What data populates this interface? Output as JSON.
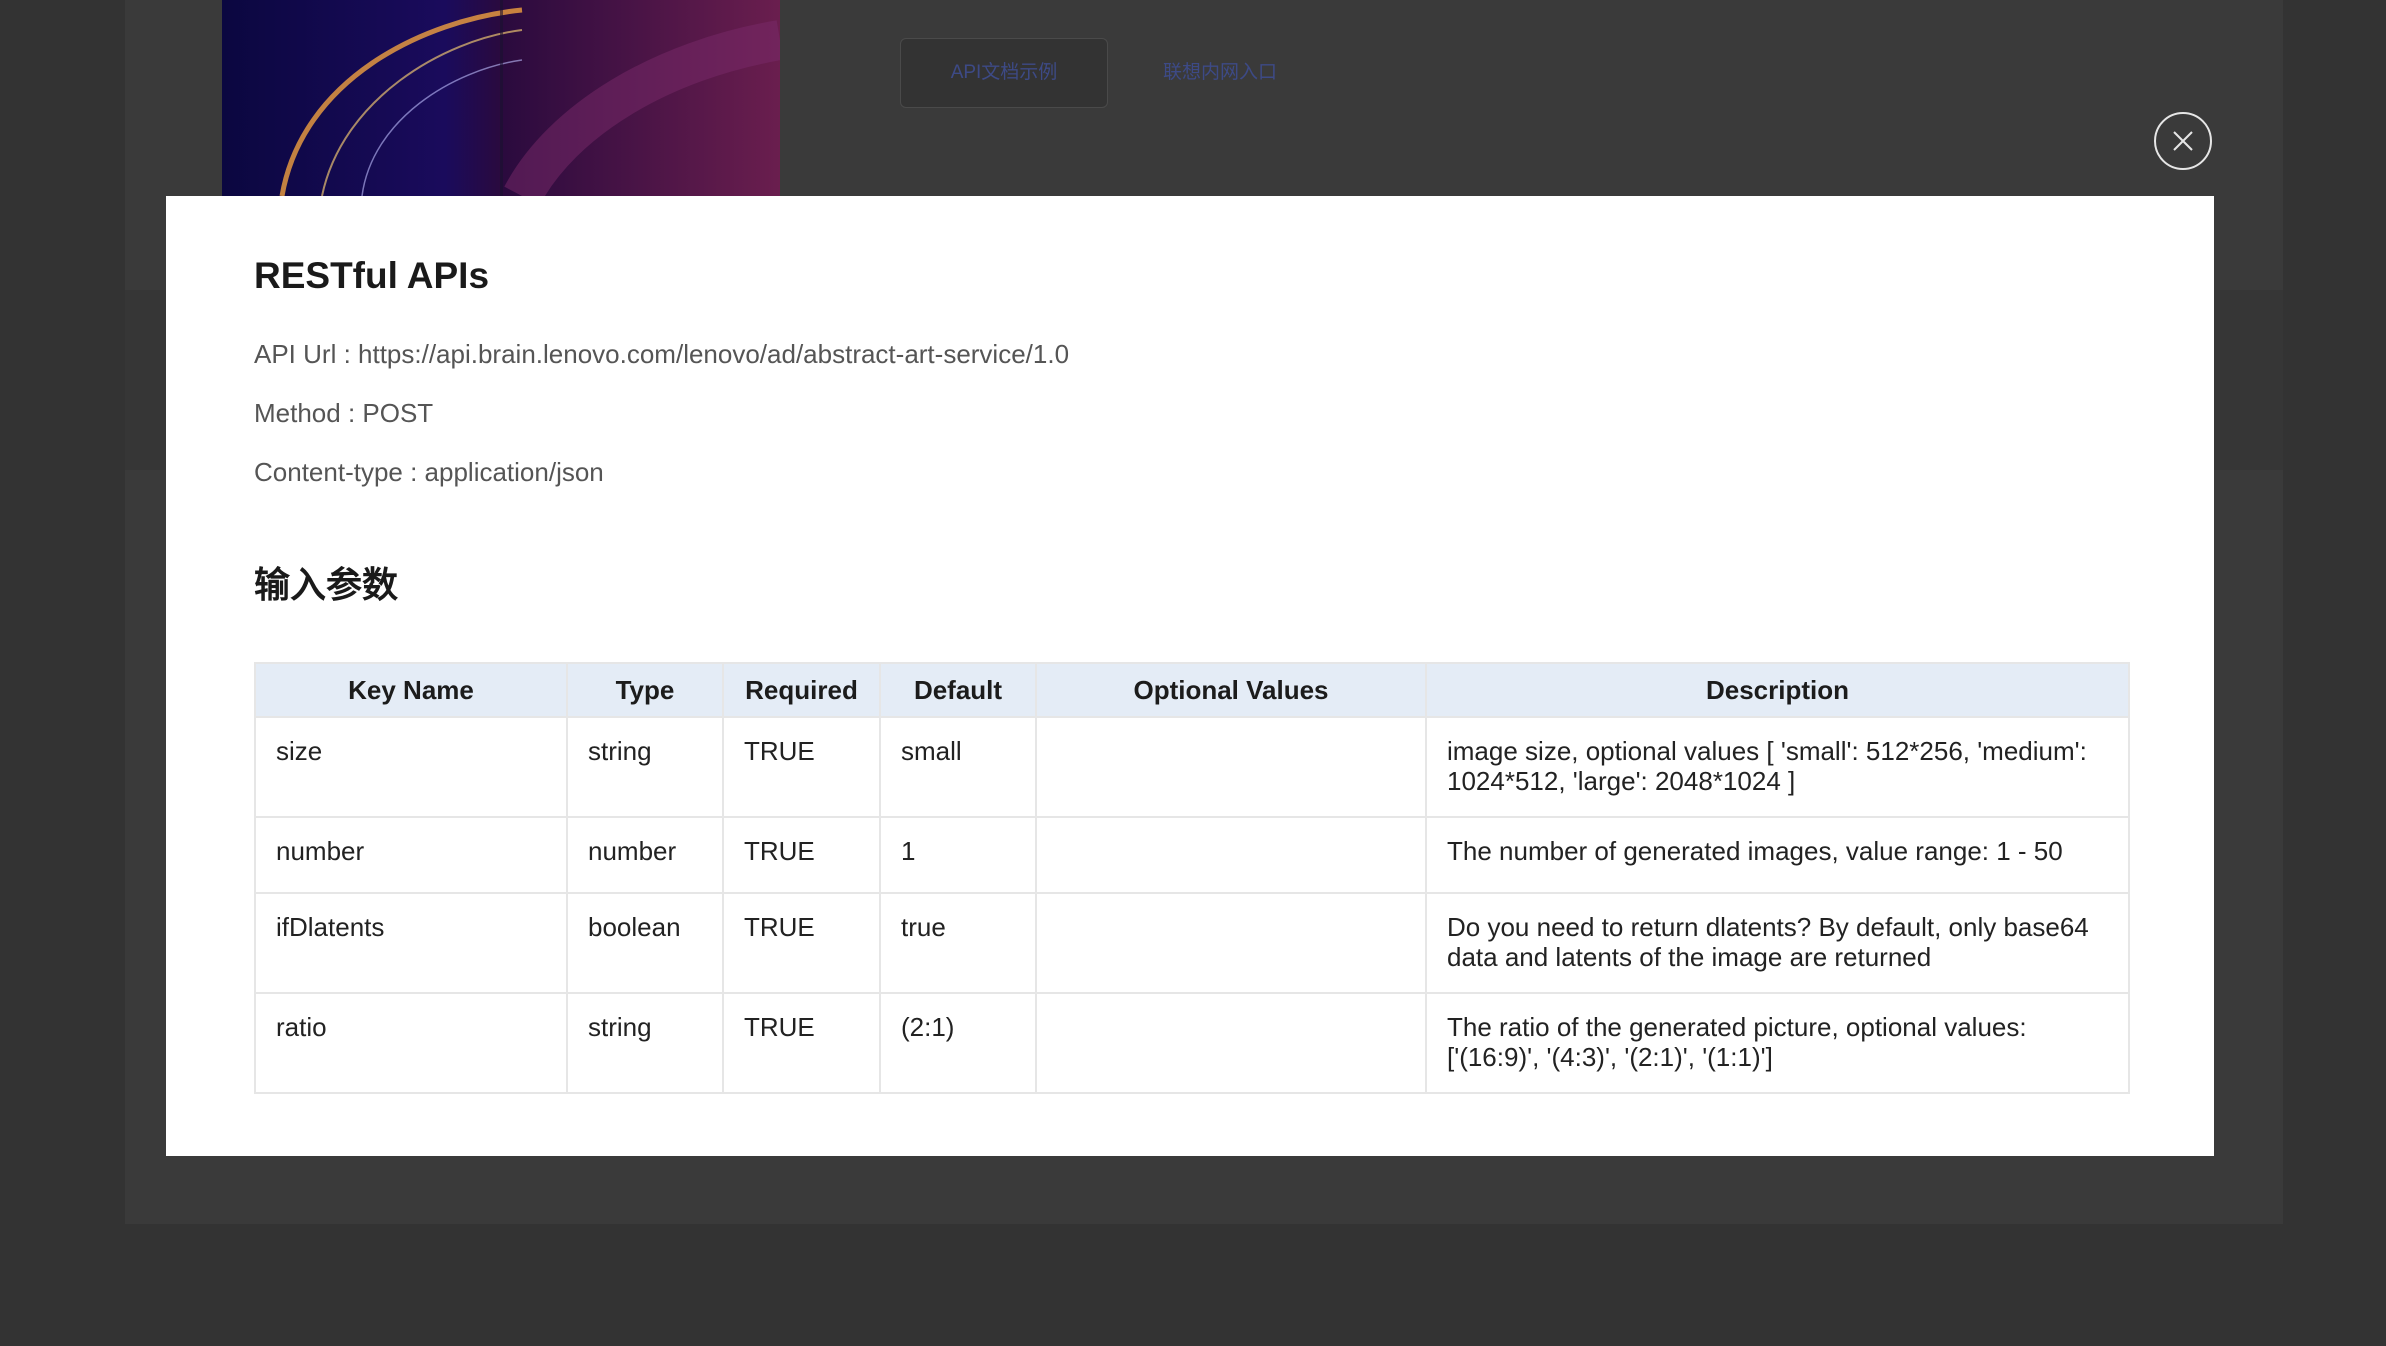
{
  "background": {
    "doc_button_label": "API文档示例",
    "intranet_link_label": "联想内网入口"
  },
  "modal": {
    "title": "RESTful APIs",
    "api_url_line": "API Url  : https://api.brain.lenovo.com/lenovo/ad/abstract-art-service/1.0",
    "method_line": "Method : POST",
    "content_type_line": "Content-type : application/json",
    "input_params_heading": "输入参数",
    "table": {
      "headers": [
        "Key Name",
        "Type",
        "Required",
        "Default",
        "Optional Values",
        "Description"
      ],
      "rows": [
        {
          "key": "size",
          "type": "string",
          "required": "TRUE",
          "default": "small",
          "optional": "",
          "description": "image size, optional values [ 'small': 512*256, 'medium': 1024*512, 'large': 2048*1024 ]"
        },
        {
          "key": "number",
          "type": "number",
          "required": "TRUE",
          "default": "1",
          "optional": "",
          "description": "The number of generated images, value range: 1 - 50"
        },
        {
          "key": "ifDlatents",
          "type": "boolean",
          "required": "TRUE",
          "default": "true",
          "optional": "",
          "description": "Do you need to return dlatents? By default, only base64 data and latents of the image are returned"
        },
        {
          "key": "ratio",
          "type": "string",
          "required": "TRUE",
          "default": "(2:1)",
          "optional": "",
          "description": "The ratio of the generated picture, optional values: ['(16:9)', '(4:3)', '(2:1)', '(1:1)']"
        }
      ]
    }
  },
  "icons": {
    "close": "close-icon"
  },
  "colors": {
    "overlay": "#333333",
    "table_header_bg": "#e4ecf6",
    "link": "#3d4a86"
  }
}
